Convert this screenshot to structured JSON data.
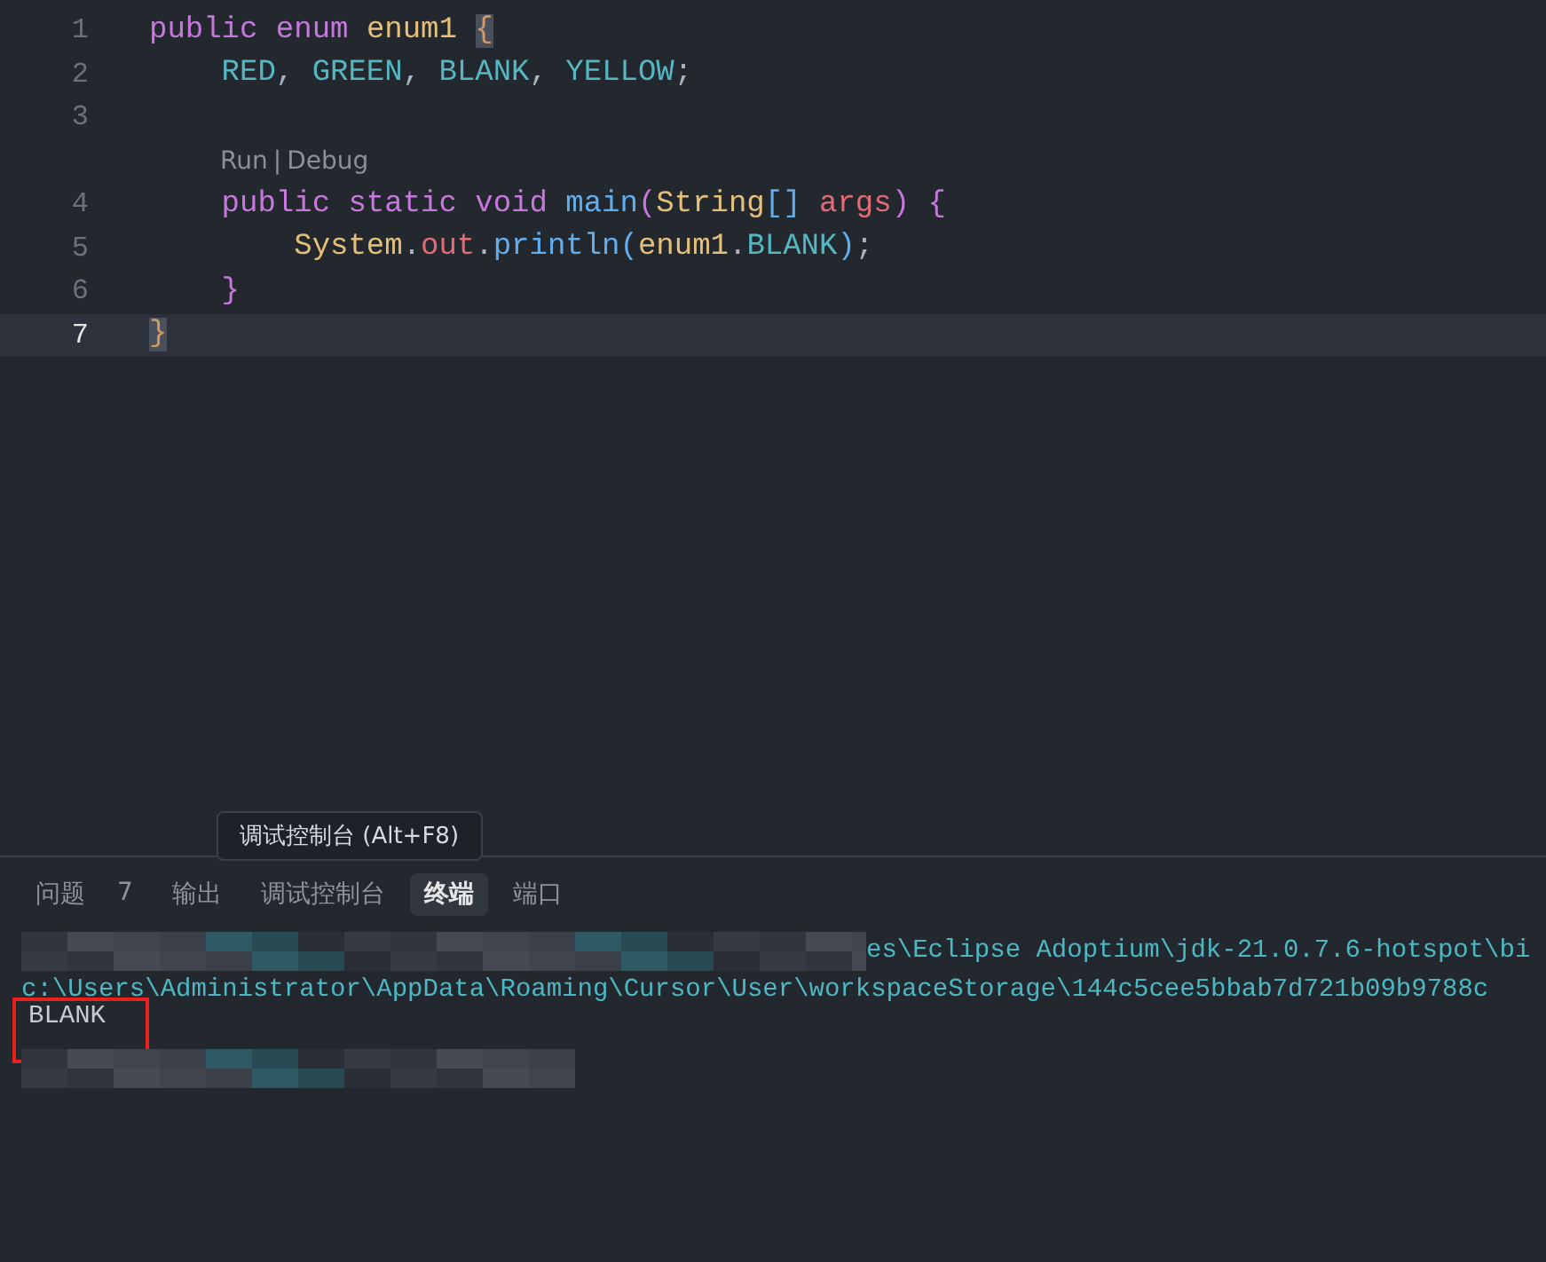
{
  "editor": {
    "lines": [
      {
        "number": "1",
        "current": false,
        "tokens": [
          {
            "kind": "keyword",
            "text": "public "
          },
          {
            "kind": "keyword",
            "text": "enum "
          },
          {
            "kind": "type",
            "text": "enum1 "
          },
          {
            "kind": "brace",
            "text": "{",
            "matched": true
          }
        ]
      },
      {
        "number": "2",
        "current": false,
        "tokens": [
          {
            "kind": "constant",
            "text": "    RED"
          },
          {
            "kind": "plain",
            "text": ", "
          },
          {
            "kind": "constant",
            "text": "GREEN"
          },
          {
            "kind": "plain",
            "text": ", "
          },
          {
            "kind": "constant",
            "text": "BLANK"
          },
          {
            "kind": "plain",
            "text": ", "
          },
          {
            "kind": "constant",
            "text": "YELLOW"
          },
          {
            "kind": "plain",
            "text": ";"
          }
        ]
      },
      {
        "number": "3",
        "current": false
      },
      {
        "kind": "codelens",
        "items": [
          "Run",
          "Debug"
        ],
        "separator": "|"
      },
      {
        "number": "4",
        "current": false,
        "tokens": [
          {
            "kind": "keyword",
            "text": "    public "
          },
          {
            "kind": "keyword",
            "text": "static "
          },
          {
            "kind": "keyword",
            "text": "void "
          },
          {
            "kind": "function",
            "text": "main"
          },
          {
            "kind": "bracket",
            "text": "("
          },
          {
            "kind": "type",
            "text": "String"
          },
          {
            "kind": "bracket2",
            "text": "[] "
          },
          {
            "kind": "param",
            "text": "args"
          },
          {
            "kind": "bracket",
            "text": ") {"
          }
        ]
      },
      {
        "number": "5",
        "current": false,
        "tokens": [
          {
            "kind": "type",
            "text": "        System"
          },
          {
            "kind": "plain",
            "text": "."
          },
          {
            "kind": "param",
            "text": "out"
          },
          {
            "kind": "plain",
            "text": "."
          },
          {
            "kind": "function",
            "text": "println"
          },
          {
            "kind": "bracket2",
            "text": "("
          },
          {
            "kind": "type",
            "text": "enum1"
          },
          {
            "kind": "plain",
            "text": "."
          },
          {
            "kind": "constant",
            "text": "BLANK"
          },
          {
            "kind": "bracket2",
            "text": ")"
          },
          {
            "kind": "plain",
            "text": ";"
          }
        ]
      },
      {
        "number": "6",
        "current": false,
        "tokens": [
          {
            "kind": "bracket",
            "text": "    }"
          }
        ]
      },
      {
        "number": "7",
        "current": true,
        "tokens": [
          {
            "kind": "brace",
            "text": "}",
            "matched": true
          }
        ]
      }
    ]
  },
  "panel": {
    "tooltip": "调试控制台 (Alt+F8)",
    "tabs": [
      {
        "label": "问题",
        "badge": "7",
        "selected": false
      },
      {
        "label": "输出",
        "selected": false
      },
      {
        "label": "调试控制台",
        "selected": false
      },
      {
        "label": "终端",
        "selected": true
      },
      {
        "label": "端口",
        "selected": false
      }
    ],
    "terminal": [
      {
        "kind": "mixed",
        "text": "es\\Eclipse Adoptium\\jdk-21.0.7.6-hotspot\\bi"
      },
      {
        "kind": "path",
        "text": "c:\\Users\\Administrator\\AppData\\Roaming\\Cursor\\User\\workspaceStorage\\144c5cee5bbab7d721b09b9788c"
      },
      {
        "kind": "output",
        "text": "BLANK",
        "boxed": true
      },
      {
        "kind": "redacted"
      }
    ]
  }
}
